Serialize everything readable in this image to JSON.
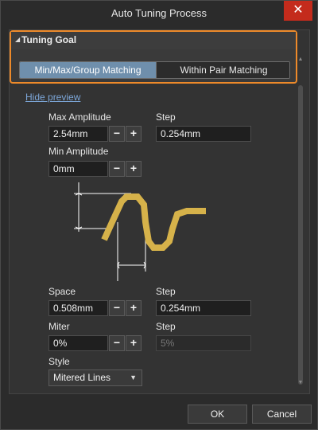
{
  "window": {
    "title": "Auto Tuning Process",
    "close_glyph": "✕"
  },
  "tuning_goal": {
    "title": "Tuning Goal",
    "collapse_glyph": "◢",
    "options": [
      "Min/Max/Group Matching",
      "Within Pair Matching"
    ],
    "selected": "Min/Max/Group Matching"
  },
  "preview_link": "Hide preview",
  "max_amplitude": {
    "label": "Max Amplitude",
    "value": "2.54mm"
  },
  "max_amplitude_step": {
    "label": "Step",
    "value": "0.254mm"
  },
  "min_amplitude": {
    "label": "Min Amplitude",
    "value": "0mm"
  },
  "space": {
    "label": "Space",
    "value": "0.508mm"
  },
  "space_step": {
    "label": "Step",
    "value": "0.254mm"
  },
  "miter": {
    "label": "Miter",
    "value": "0%"
  },
  "miter_step": {
    "label": "Step",
    "value": "5%",
    "disabled": true
  },
  "style": {
    "label": "Style",
    "value": "Mitered Lines",
    "caret": "▼"
  },
  "stepper": {
    "minus": "−",
    "plus": "+"
  },
  "scroll": {
    "up": "▲",
    "down": "▼"
  },
  "footer": {
    "ok": "OK",
    "cancel": "Cancel"
  },
  "colors": {
    "accent_orange": "#ee8a2a",
    "selected_tab": "#6f8fac",
    "trace": "#d6b24a",
    "link": "#7da7d9",
    "close": "#c42b1c"
  },
  "icons": [
    "close-icon",
    "collapse-triangle-icon",
    "minus-icon",
    "plus-icon",
    "chevron-down-icon",
    "scroll-up-icon",
    "scroll-down-icon"
  ]
}
